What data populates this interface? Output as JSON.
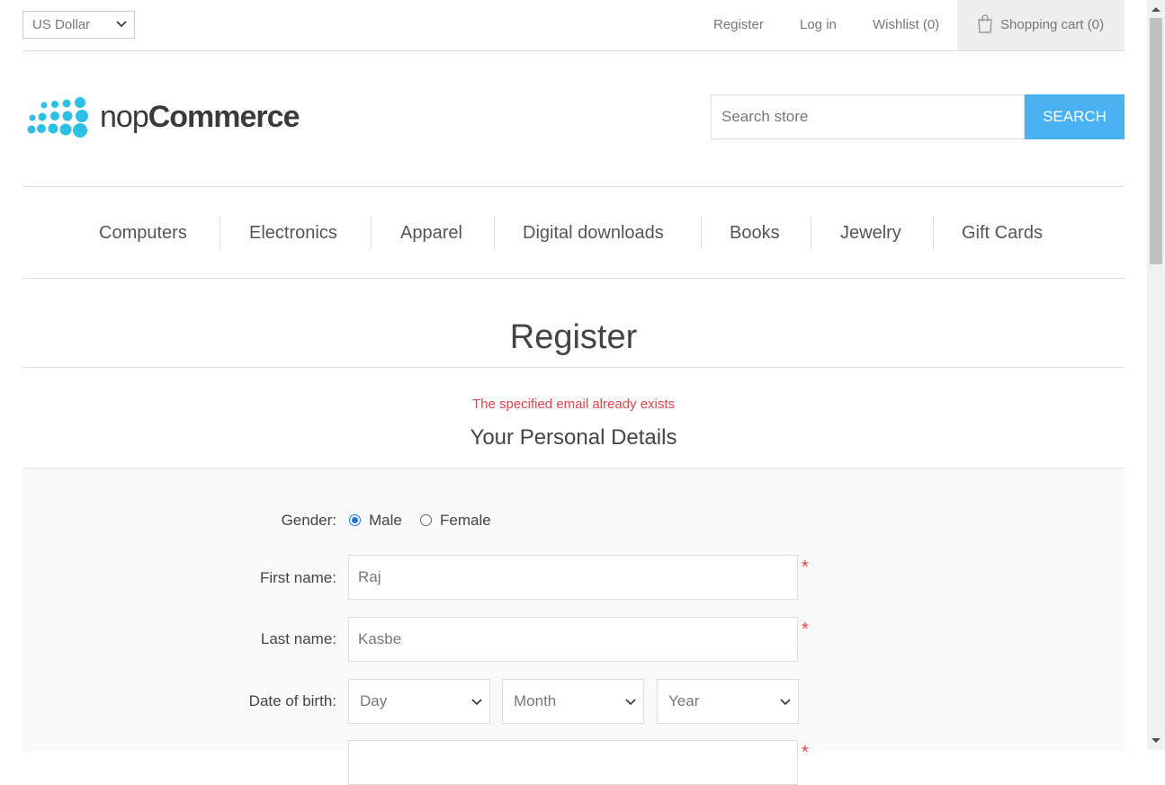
{
  "header": {
    "currency": "US Dollar",
    "register": "Register",
    "login": "Log in",
    "wishlist": "Wishlist (0)",
    "cart": "Shopping cart (0)"
  },
  "logo": {
    "prefix": "nop",
    "suffix": "Commerce"
  },
  "search": {
    "placeholder": "Search store",
    "button": "SEARCH"
  },
  "nav": [
    "Computers",
    "Electronics",
    "Apparel",
    "Digital downloads",
    "Books",
    "Jewelry",
    "Gift Cards"
  ],
  "page": {
    "title": "Register",
    "error": "The specified email already exists",
    "section_title": "Your Personal Details"
  },
  "form": {
    "gender_label": "Gender:",
    "gender_options": [
      "Male",
      "Female"
    ],
    "gender_selected": "Male",
    "first_name_label": "First name:",
    "first_name_value": "Raj",
    "last_name_label": "Last name:",
    "last_name_value": "Kasbe",
    "dob_label": "Date of birth:",
    "dob_day": "Day",
    "dob_month": "Month",
    "dob_year": "Year",
    "required_mark": "*"
  },
  "colors": {
    "accent": "#4ab2f1",
    "error": "#e4434b",
    "logo_dots": "#2bc0e4"
  }
}
